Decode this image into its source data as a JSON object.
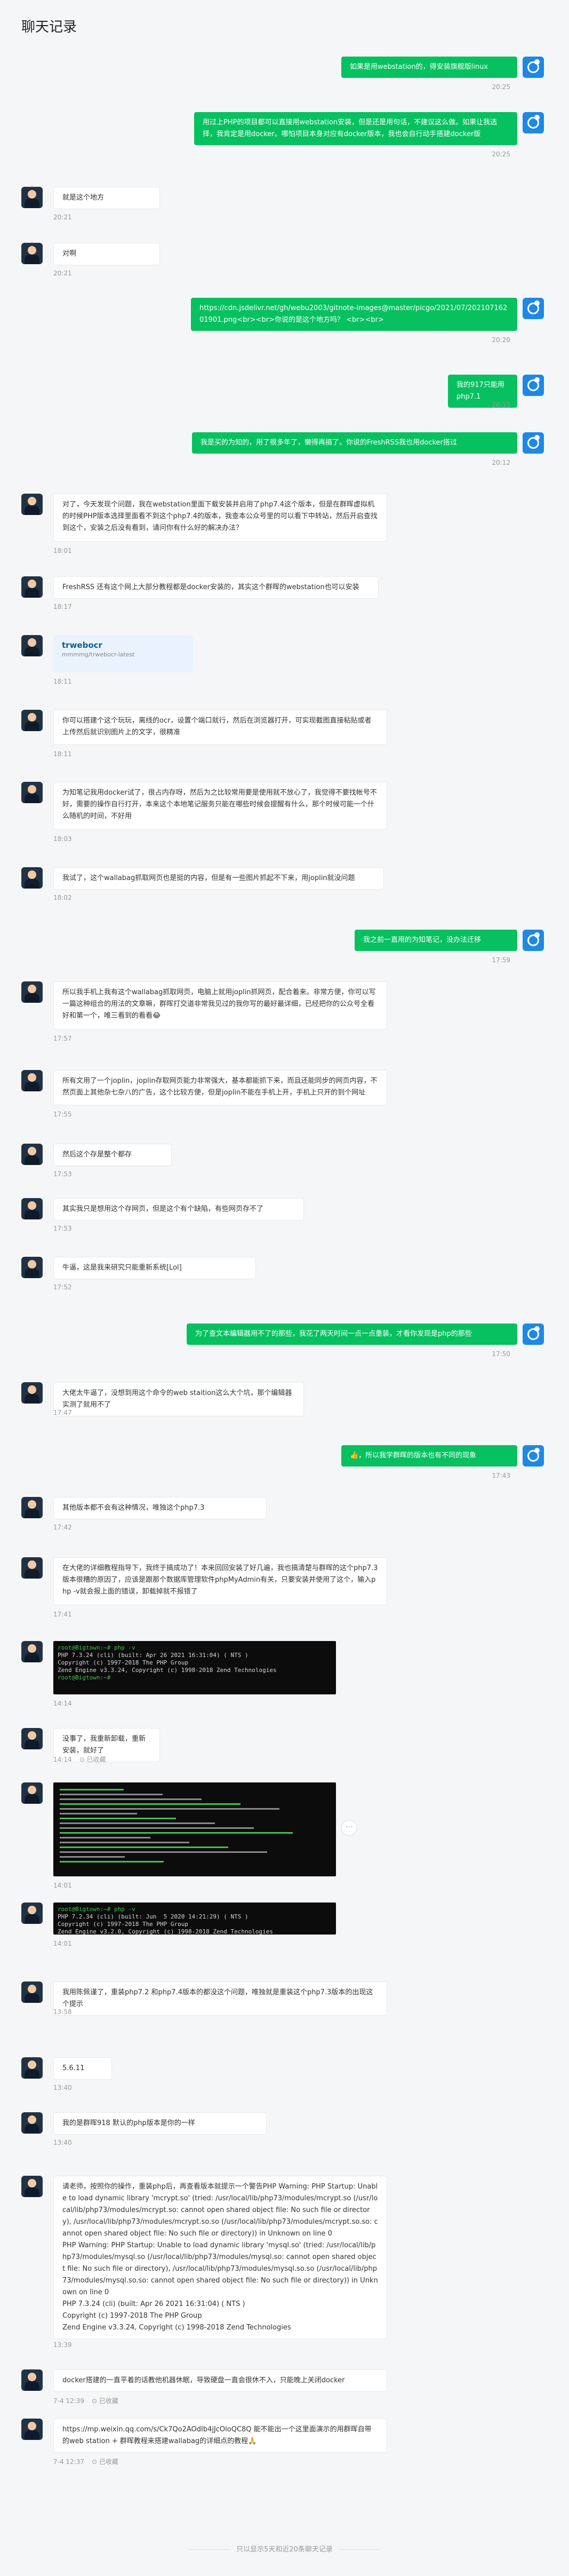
{
  "header": {
    "title": "聊天记录"
  },
  "messages": [
    {
      "side": "r",
      "text": "如果是用webstation的，得安装旗舰版linux",
      "time": "20:25"
    },
    {
      "side": "r",
      "text": "用过上PHP的项目都可以直接用webstation安装，但是还是用句话，不建议这么做。如果让我选择，我肯定是用docker。哪怕项目本身对应有docker版本，我也会自行动手搭建docker版",
      "time": "20:25"
    },
    {
      "side": "l",
      "text": "就是这个地方",
      "time": "20:21"
    },
    {
      "side": "l",
      "text": "对啊",
      "time": "20:21"
    },
    {
      "side": "r",
      "text": "https://cdn.jsdelivr.net/gh/webu2003/gitnote-images@master/picgo/2021/07/20210716201901.png<br><br>你说的是这个地方吗？ <br><br>",
      "time": "20:20"
    },
    {
      "side": "r",
      "text": "我的917只能用php7.1",
      "time": "20:13"
    },
    {
      "side": "r",
      "text": "我是买的为知的，用了很多年了，懒得再搞了。你说的FreshRSS我也用docker搭过",
      "time": "20:12"
    },
    {
      "side": "l",
      "text": "对了，今天发现个问题，我在webstation里面下载安装并启用了php7.4这个版本，但是在群晖虚拟机的时候PHP版本选择里面看不到这个php7.4的版本，我查本公众号里的可以看下中转站，然后开启查找到这个，安装之后没有看到，请问你有什么好的解决办法？",
      "time": "18:01"
    },
    {
      "side": "l",
      "text": "FreshRSS 还有这个网上大部分教程都是docker安装的，其实这个群晖的webstation也可以安装",
      "time": "18:17"
    },
    {
      "side": "l",
      "kind": "card",
      "card_title": "trwebocr",
      "card_sub": "mmmmg/trwebocr-latest",
      "time": "18:11"
    },
    {
      "side": "l",
      "text": "你可以搭建个这个玩玩，离线的ocr，设置个端口就行，然后在浏览器打开，可实现截图直接粘贴或者上传然后就识别图片上的文字，很精准",
      "time": "18:11"
    },
    {
      "side": "l",
      "text": "为知笔记我用docker试了，很占内存呀，然后为之比较常用要是使用就不放心了，我觉得不要找帐号不好，需要的操作自行打开，本来这个本地笔记服务只能在哪些时候会提醒有什么，那个时候可能一个什么随机的时间，不好用",
      "time": "18:03"
    },
    {
      "side": "l",
      "text": "我试了，这个wallabag抓取网页也是挺的内容，但是有一些图片抓起不下来，用joplin就没问题",
      "time": "18:02"
    },
    {
      "side": "r",
      "text": "我之前一直用的为知笔记，没办法迁移",
      "time": "17:59"
    },
    {
      "side": "l",
      "text": "所以我手机上我有这个wallabag抓取网页，电脑上就用joplin抓网页，配合着来。非常方便，你可以写一篇这种组合的用法的文章嘛，群晖打交道非常我见过的我你写的最好最详细，已经把你的公众号全看好和第一个，唯三看到的看看😂",
      "time": "17:57"
    },
    {
      "side": "l",
      "text": "所有文用了一个joplin，joplin存取网页能力非常强大，基本都能抓下来，而且还能同步的网页内容，不然页面上其他杂七杂八的广告，这个比较方便，但是joplin不能在手机上开，手机上只开的到个网址",
      "time": "17:55"
    },
    {
      "side": "l",
      "text": "然后这个存是整个都存",
      "time": "17:53"
    },
    {
      "side": "l",
      "text": "其实我只是想用这个存网页，但是这个有个缺陷，有些网页存不了",
      "time": "17:53"
    },
    {
      "side": "l",
      "text": "牛逼，这是我来研究只能重新系统[Lol]",
      "time": "17:52"
    },
    {
      "side": "r",
      "text": "为了查文本编辑器用不了的那些，我花了两天时间一点一点重装，才看你发现是php的那些",
      "time": "17:50"
    },
    {
      "side": "l",
      "text": "大佬太牛逼了，没想到用这个命令的web staition这么大个坑，那个编辑器实测了就用不了",
      "time": "17:47"
    },
    {
      "side": "r",
      "text": "👍，所以我学群晖的版本也有不同的现象",
      "time": "17:43"
    },
    {
      "side": "l",
      "text": "其他版本都不会有这种情况，唯独这个php7.3",
      "time": "17:42"
    },
    {
      "side": "l",
      "text": "在大佬的详细教程指导下，我终于搞成功了！本来回回安装了好几遍，我也搞清楚与群晖的这个php7.3版本很糟的原因了，应该是跟那个数据库管理软件phpMyAdmin有关，只要安装并使用了这个，输入php -v就会报上面的错误，卸载掉就不报错了",
      "time": "17:41"
    },
    {
      "side": "l",
      "kind": "term",
      "lines": [
        "root@Bigtown:~# php -v",
        "PHP 7.3.24 (cli) (built: Apr 26 2021 16:31:04) ( NTS )",
        "Copyright (c) 1997-2018 The PHP Group",
        "Zend Engine v3.3.24, Copyright (c) 1998-2018 Zend Technologies",
        "root@Bigtown:~#"
      ],
      "time": "14:14"
    },
    {
      "side": "l",
      "text": "没事了，我重新卸载，重新安装，就好了",
      "time": "14:14",
      "fav": "已收藏"
    },
    {
      "side": "l",
      "kind": "term2",
      "time": "14:01"
    },
    {
      "side": "l",
      "kind": "term3",
      "lines": [
        "root@Bigtown:~# php -v",
        "PHP 7.2.34 (cli) (built: Jun  5 2020 14:21:29) ( NTS )",
        "Copyright (c) 1997-2018 The PHP Group",
        "Zend Engine v3.2.0, Copyright (c) 1998-2018 Zend Technologies"
      ],
      "time": "14:01"
    },
    {
      "side": "l",
      "text": "我用陈佩谨了，重装php7.2 和php7.4版本的都没这个问题，唯独就是重装这个php7.3版本的出现这个提示",
      "time": "13:58"
    },
    {
      "side": "l",
      "text": "5.6.11",
      "time": "13:40"
    },
    {
      "side": "l",
      "text": "我的是群晖918 默认的php版本是你的一样",
      "time": "13:40"
    },
    {
      "side": "l",
      "text": "请老师，按照你的操作，重装php后，再查看版本就提示一个警告PHP Warning: PHP Startup: Unable to load dynamic library 'mcrypt.so' (tried: /usr/local/lib/php73/modules/mcrypt.so (/usr/local/lib/php73/modules/mcrypt.so: cannot open shared object file: No such file or directory), /usr/local/lib/php73/modules/mcrypt.so.so (/usr/local/lib/php73/modules/mcrypt.so.so: cannot open shared object file: No such file or directory)) in Unknown on line 0\nPHP Warning: PHP Startup: Unable to load dynamic library 'mysql.so' (tried: /usr/local/lib/php73/modules/mysql.so (/usr/local/lib/php73/modules/mysql.so: cannot open shared object file: No such file or directory), /usr/local/lib/php73/modules/mysql.so.so (/usr/local/lib/php73/modules/mysql.so.so: cannot open shared object file: No such file or directory)) in Unknown on line 0\nPHP 7.3.24 (cli) (built: Apr 26 2021 16:31:04) ( NTS )\nCopyright (c) 1997-2018 The PHP Group\nZend Engine v3.3.24, Copyright (c) 1998-2018 Zend Technologies",
      "time": "13:39"
    },
    {
      "side": "l",
      "text": "docker搭建的一直平着的话教他机器休眠，导致硬盘一直会很休不入，只能晚上关闭docker",
      "time": "7-4 12:39",
      "fav": "已收藏"
    },
    {
      "side": "l",
      "text": "https://mp.weixin.qq.com/s/Ck7Qo2AOdIb4jJcOloQC8Q 能不能出一个这里面演示的用群晖自带的web station + 群晖教程来搭建wallabag的详细点的教程🙏",
      "time": "7-4 12:37",
      "fav": "已收藏"
    }
  ],
  "footer": {
    "text": "只以显示5天和近20条聊天记录"
  }
}
